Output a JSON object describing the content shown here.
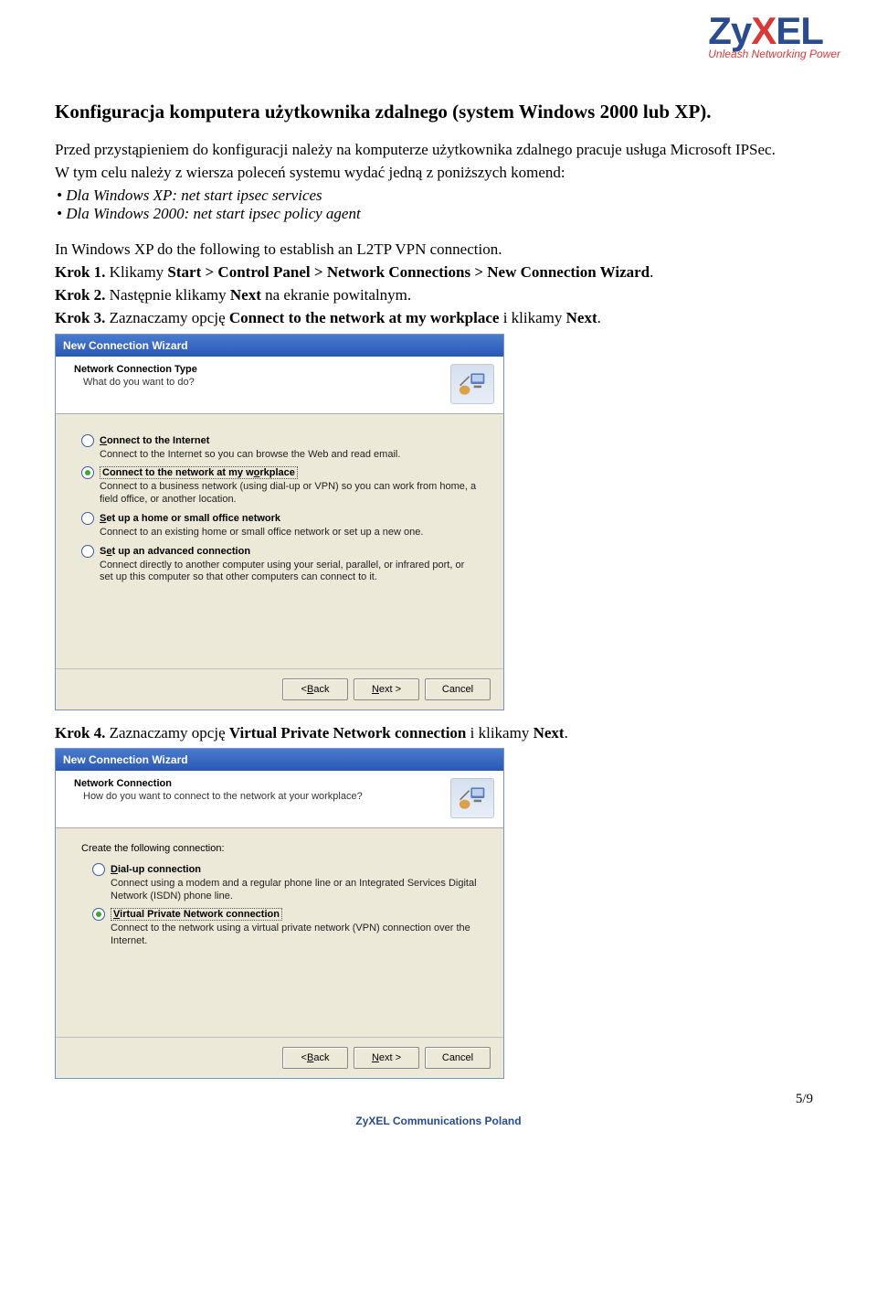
{
  "logo": {
    "brand_a": "Z",
    "brand_b": "y",
    "brand_c": "X",
    "brand_d": "EL",
    "tagline": "Unleash Networking Power"
  },
  "heading": "Konfiguracja komputera użytkownika zdalnego (system Windows 2000 lub XP).",
  "intro": "Przed przystąpieniem do konfiguracji należy na komputerze użytkownika zdalnego pracuje usługa Microsoft IPSec.",
  "cmd_intro": "W tym celu należy z wiersza poleceń systemu wydać jedną z poniższych komend:",
  "cmd_xp": "• Dla Windows XP: net start ipsec services",
  "cmd_2000": "• Dla Windows 2000: net start ipsec policy agent",
  "english_line": "In Windows XP do the following to establish an L2TP VPN connection.",
  "krok1_a": "Krok 1.",
  "krok1_b": " Klikamy ",
  "krok1_c": "Start > Control Panel > Network Connections > New Connection Wizard",
  "krok1_d": ".",
  "krok2_a": "Krok 2.",
  "krok2_b": " Następnie klikamy ",
  "krok2_c": "Next",
  "krok2_d": " na ekranie powitalnym.",
  "krok3_a": "Krok 3.",
  "krok3_b": " Zaznaczamy opcję ",
  "krok3_c": "Connect to the network at my workplace",
  "krok3_d": " i klikamy ",
  "krok3_e": "Next",
  "krok3_f": ".",
  "krok4_a": "Krok 4.",
  "krok4_b": " Zaznaczamy opcję ",
  "krok4_c": "Virtual Private Network connection",
  "krok4_d": " i klikamy ",
  "krok4_e": "Next",
  "krok4_f": ".",
  "wizard1": {
    "title": "New Connection Wizard",
    "banner_heading": "Network Connection Type",
    "banner_sub": "What do you want to do?",
    "opt1": {
      "u": "C",
      "rest": "onnect to the Internet",
      "desc": "Connect to the Internet so you can browse the Web and read email."
    },
    "opt2": {
      "u": "o",
      "pre": "Connect to the network at my w",
      "rest": "rkplace",
      "desc": "Connect to a business network (using dial-up or VPN) so you can work from home, a field office, or another location."
    },
    "opt3": {
      "u": "S",
      "rest": "et up a home or small office network",
      "desc": "Connect to an existing home or small office network or set up a new one."
    },
    "opt4": {
      "u": "e",
      "pre": "S",
      "rest": "t up an advanced connection",
      "desc": "Connect directly to another computer using your serial, parallel, or infrared port, or set up this computer so that other computers can connect to it."
    }
  },
  "wizard2": {
    "title": "New Connection Wizard",
    "banner_heading": "Network Connection",
    "banner_sub": "How do you want to connect to the network at your workplace?",
    "create": "Create the following connection:",
    "opt1": {
      "u": "D",
      "rest": "ial-up connection",
      "desc": "Connect using a modem and a regular phone line or an Integrated Services Digital Network (ISDN) phone line."
    },
    "opt2": {
      "u": "V",
      "rest": "irtual Private Network connection",
      "desc": "Connect to the network using a virtual private network (VPN) connection over the Internet."
    }
  },
  "buttons": {
    "back_u": "B",
    "back": "ack",
    "next_u": "N",
    "next": "ext >",
    "cancel": "Cancel",
    "lt": "< "
  },
  "footer": "ZyXEL Communications Poland",
  "page_num": "5/9"
}
